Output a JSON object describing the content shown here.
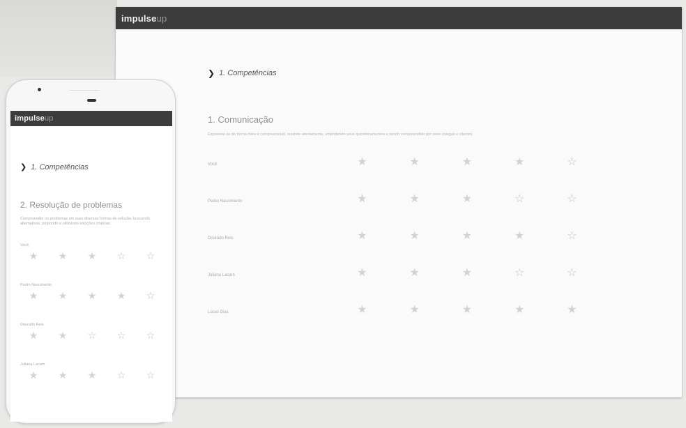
{
  "app": {
    "logo_main": "impulse",
    "logo_suffix": "up"
  },
  "desktop": {
    "section_heading": "1. Competências",
    "title": "1. Comunicação",
    "description": "Expressar-se de forma clara e compreensível, ouvindo atentamente, entendendo seus questionamentos e sendo compreendido por seus colegas e clientes.",
    "rows": [
      {
        "name": "Você",
        "stars": [
          {
            "filled": true,
            "label": ""
          },
          {
            "filled": true,
            "label": ""
          },
          {
            "filled": true,
            "label": ""
          },
          {
            "filled": true,
            "label": ""
          },
          {
            "filled": false,
            "label": ""
          }
        ]
      },
      {
        "name": "Pedro Nascimento",
        "stars": [
          {
            "filled": true,
            "label": ""
          },
          {
            "filled": true,
            "label": ""
          },
          {
            "filled": true,
            "label": ""
          },
          {
            "filled": false,
            "label": ""
          },
          {
            "filled": false,
            "label": ""
          }
        ]
      },
      {
        "name": "Dourado Reis",
        "stars": [
          {
            "filled": true,
            "label": ""
          },
          {
            "filled": true,
            "label": ""
          },
          {
            "filled": true,
            "label": ""
          },
          {
            "filled": true,
            "label": ""
          },
          {
            "filled": false,
            "label": ""
          }
        ]
      },
      {
        "name": "Juliana Lacam",
        "stars": [
          {
            "filled": true,
            "label": ""
          },
          {
            "filled": true,
            "label": ""
          },
          {
            "filled": true,
            "label": ""
          },
          {
            "filled": false,
            "label": ""
          },
          {
            "filled": false,
            "label": ""
          }
        ]
      },
      {
        "name": "Lucas Dias",
        "stars": [
          {
            "filled": true,
            "label": ""
          },
          {
            "filled": true,
            "label": ""
          },
          {
            "filled": true,
            "label": ""
          },
          {
            "filled": true,
            "label": ""
          },
          {
            "filled": true,
            "label": ""
          }
        ]
      }
    ]
  },
  "phone": {
    "section_heading": "1. Competências",
    "title": "2. Resolução de problemas",
    "description": "Compreender os problemas em suas diversas formas de solução, buscando alternativas, propondo e utilizando soluções criativas.",
    "groups": [
      {
        "name": "Você",
        "stars": [
          {
            "filled": true,
            "label": ""
          },
          {
            "filled": true,
            "label": ""
          },
          {
            "filled": true,
            "label": ""
          },
          {
            "filled": false,
            "label": ""
          },
          {
            "filled": false,
            "label": ""
          }
        ]
      },
      {
        "name": "Pedro Nascimento",
        "stars": [
          {
            "filled": true,
            "label": ""
          },
          {
            "filled": true,
            "label": ""
          },
          {
            "filled": true,
            "label": ""
          },
          {
            "filled": true,
            "label": ""
          },
          {
            "filled": false,
            "label": ""
          }
        ]
      },
      {
        "name": "Dourado Reis",
        "stars": [
          {
            "filled": true,
            "label": ""
          },
          {
            "filled": true,
            "label": ""
          },
          {
            "filled": false,
            "label": ""
          },
          {
            "filled": false,
            "label": ""
          },
          {
            "filled": false,
            "label": ""
          }
        ]
      },
      {
        "name": "Juliana Lacam",
        "stars": [
          {
            "filled": true,
            "label": ""
          },
          {
            "filled": true,
            "label": ""
          },
          {
            "filled": true,
            "label": ""
          },
          {
            "filled": false,
            "label": ""
          },
          {
            "filled": false,
            "label": ""
          }
        ]
      }
    ]
  },
  "icons": {
    "section_chevron": "chevron-right-icon",
    "star_filled": "star-filled-icon",
    "star_empty": "star-outline-icon"
  }
}
